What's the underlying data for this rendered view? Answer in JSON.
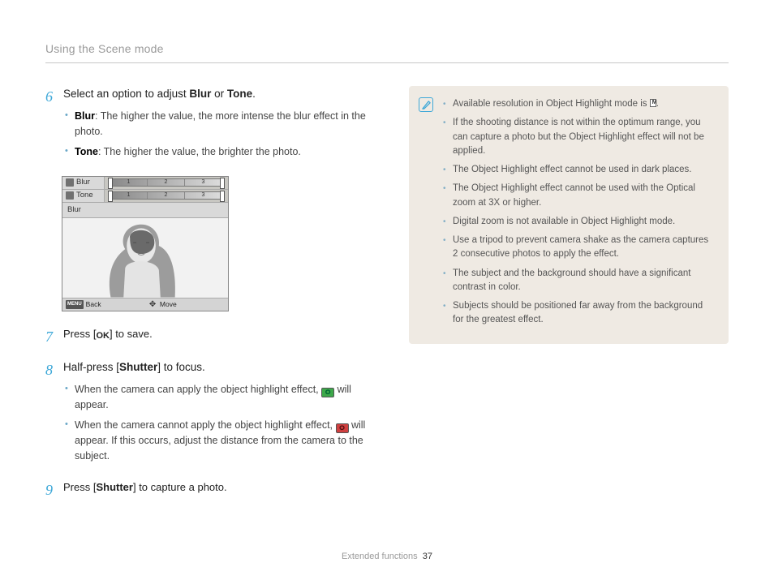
{
  "header": {
    "title": "Using the Scene mode"
  },
  "steps": {
    "s6": {
      "num": "6",
      "line_a": "Select an option to adjust ",
      "bold_a": "Blur",
      "or": " or ",
      "bold_b": "Tone",
      "line_end": ".",
      "bullets": [
        {
          "term": "Blur",
          "text": ": The higher the value, the more intense the blur effect in the photo."
        },
        {
          "term": "Tone",
          "text": ": The higher the value, the brighter the photo."
        }
      ]
    },
    "s7": {
      "num": "7",
      "pre": "Press [",
      "ok": "OK",
      "post": "] to save."
    },
    "s8": {
      "num": "8",
      "pre": "Half-press [",
      "btn": "Shutter",
      "post": "] to focus.",
      "bullets": [
        {
          "text_a": "When the camera can apply the object highlight effect, ",
          "text_b": " will appear."
        },
        {
          "text_a": "When the camera cannot apply the object highlight effect, ",
          "text_b": " will appear. If this occurs, adjust the distance from the camera to the subject."
        }
      ]
    },
    "s9": {
      "num": "9",
      "pre": "Press [",
      "btn": "Shutter",
      "post": "] to capture a photo."
    }
  },
  "camera_screen": {
    "rows": [
      {
        "label": "Blur",
        "ticks": [
          "1",
          "2",
          "3"
        ]
      },
      {
        "label": "Tone",
        "ticks": [
          "1",
          "2",
          "3"
        ]
      }
    ],
    "current": "Blur",
    "footer": {
      "back": "Back",
      "move": "Move",
      "menu": "MENU"
    }
  },
  "notes": {
    "items": [
      "Available resolution in Object Highlight mode is ",
      "If the shooting distance is not within the optimum range, you can capture a photo but the Object Highlight effect will not be applied.",
      "The Object Highlight effect cannot be used in dark places.",
      "The Object Highlight effect cannot be used with the Optical zoom at 3X or higher.",
      "Digital zoom is not available in Object Highlight mode.",
      "Use a tripod to prevent camera shake as the camera captures 2 consecutive photos to apply the effect.",
      "The subject and the background should have a significant contrast in color.",
      "Subjects should be positioned far away from the background for the greatest effect."
    ],
    "res_suffix": "."
  },
  "footer": {
    "section": "Extended functions",
    "page": "37"
  }
}
